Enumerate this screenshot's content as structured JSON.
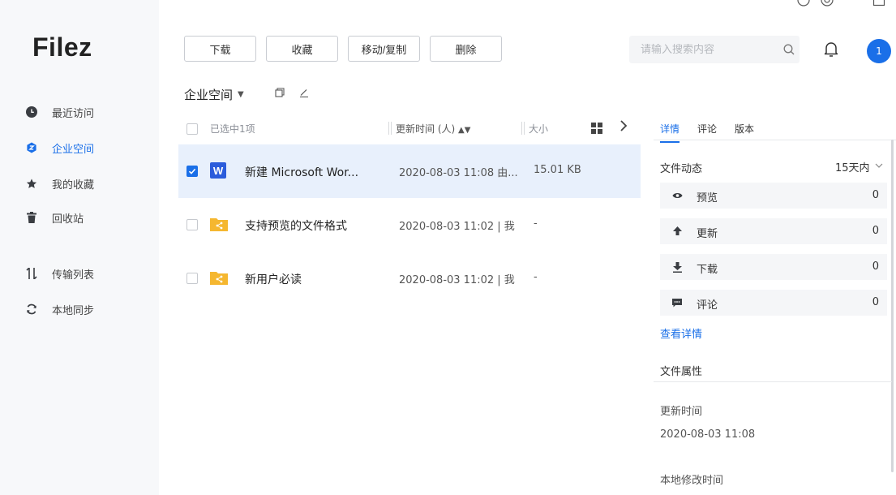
{
  "app": {
    "logo": "Filez"
  },
  "sidebar": {
    "items": [
      {
        "label": "最近访问",
        "icon": "clock-icon"
      },
      {
        "label": "企业空间",
        "icon": "enterprise-space-icon"
      },
      {
        "label": "我的收藏",
        "icon": "star-icon"
      },
      {
        "label": "回收站",
        "icon": "trash-icon"
      },
      {
        "label": "传输列表",
        "icon": "transfer-icon"
      },
      {
        "label": "本地同步",
        "icon": "sync-icon"
      }
    ],
    "active_index": 1
  },
  "toolbar": {
    "download": "下载",
    "favorite": "收藏",
    "move_copy": "移动/复制",
    "delete": "删除"
  },
  "search": {
    "placeholder": "请输入搜索内容"
  },
  "user": {
    "avatar_badge": "1"
  },
  "breadcrumb": {
    "current": "企业空间"
  },
  "file_list": {
    "selected_text": "已选中1项",
    "col_time": "更新时间 (人)",
    "col_size": "大小",
    "rows": [
      {
        "name": "新建 Microsoft Wor...",
        "time": "2020-08-03 11:08 由...",
        "size": "15.01 KB",
        "icon": "word-file-icon",
        "checked": true
      },
      {
        "name": "支持预览的文件格式",
        "time": "2020-08-03 11:02 | 我",
        "size": "-",
        "icon": "shared-folder-icon",
        "checked": false
      },
      {
        "name": "新用户必读",
        "time": "2020-08-03 11:02 | 我",
        "size": "-",
        "icon": "shared-folder-icon",
        "checked": false
      }
    ]
  },
  "detail_panel": {
    "tabs": [
      "详情",
      "评论",
      "版本"
    ],
    "active_tab": 0,
    "activity_title": "文件动态",
    "period": "15天内",
    "activities": [
      {
        "label": "预览",
        "count": "0",
        "icon": "eye-icon"
      },
      {
        "label": "更新",
        "count": "0",
        "icon": "upload-arrow-icon"
      },
      {
        "label": "下载",
        "count": "0",
        "icon": "download-arrow-icon"
      },
      {
        "label": "评论",
        "count": "0",
        "icon": "comment-icon"
      }
    ],
    "view_details_link": "查看详情",
    "properties_title": "文件属性",
    "updated_label": "更新时间",
    "updated_value": "2020-08-03 11:08",
    "local_modified_label": "本地修改时间"
  },
  "colors": {
    "accent": "#1a6fe8",
    "folder": "#f5b730",
    "word": "#2b5cdb"
  }
}
